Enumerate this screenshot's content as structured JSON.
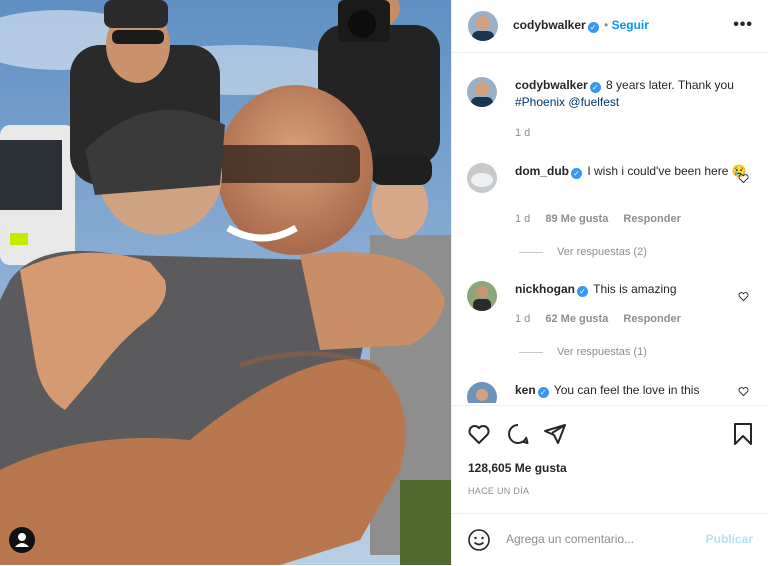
{
  "header": {
    "username": "codybwalker",
    "follow_label": "Seguir",
    "more_icon": "more-options-icon"
  },
  "caption": {
    "username": "codybwalker",
    "text": " 8 years later. Thank you",
    "hashtag": "#Phoenix",
    "mention": "@fuelfest",
    "time": "1 d"
  },
  "comments": [
    {
      "username": "dom_dub",
      "text": " I wish i could've been here",
      "emoji": "😢",
      "time": "1 d",
      "likes": "89 Me gusta",
      "reply": "Responder",
      "view_replies": "Ver respuestas (2)"
    },
    {
      "username": "nickhogan",
      "text": " This is amazing",
      "time": "1 d",
      "likes": "62 Me gusta",
      "reply": "Responder",
      "view_replies": "Ver respuestas (1)"
    },
    {
      "username": "ken",
      "text": " You can feel the love in this"
    }
  ],
  "stats": {
    "likes": "128,605 Me gusta",
    "date": "HACE UN DÍA"
  },
  "add_comment": {
    "placeholder": "Agrega un comentario...",
    "publish_label": "Publicar"
  },
  "colors": {
    "accent": "#0095f6",
    "verified": "#3897f0",
    "publish_disabled": "#b2dffc"
  }
}
